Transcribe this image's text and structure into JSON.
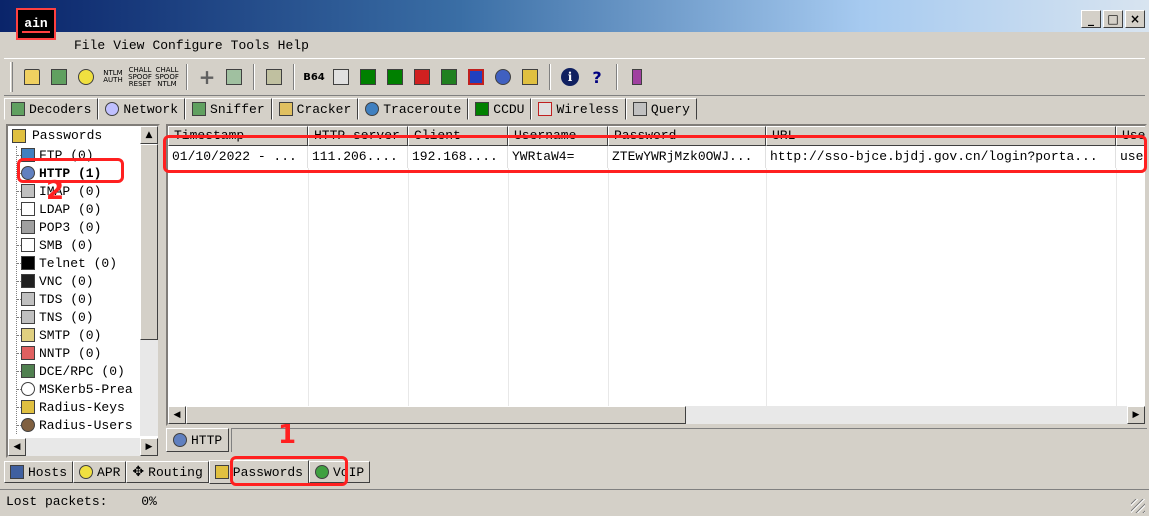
{
  "window": {
    "logo_text": "ain",
    "controls": [
      "_",
      "□",
      "×"
    ]
  },
  "menu": [
    "File",
    "View",
    "Configure",
    "Tools",
    "Help"
  ],
  "toolbar": {
    "ntlm_auth": "NTLM AUTH",
    "chall_spoof_reset": "CHALL SPOOF RESET",
    "chall_spoof_ntlm": "CHALL SPOOF NTLM",
    "b64": "B64"
  },
  "top_tabs": [
    {
      "label": "Decoders",
      "icon": "decoder-icon"
    },
    {
      "label": "Network",
      "icon": "network-icon"
    },
    {
      "label": "Sniffer",
      "icon": "sniffer-icon"
    },
    {
      "label": "Cracker",
      "icon": "cracker-icon"
    },
    {
      "label": "Traceroute",
      "icon": "traceroute-icon"
    },
    {
      "label": "CCDU",
      "icon": "ccdu-icon"
    },
    {
      "label": "Wireless",
      "icon": "wireless-icon"
    },
    {
      "label": "Query",
      "icon": "query-icon"
    }
  ],
  "tree": {
    "root": "Passwords",
    "items": [
      {
        "label": "FTP (0)"
      },
      {
        "label": "HTTP (1)"
      },
      {
        "label": "IMAP (0)"
      },
      {
        "label": "LDAP (0)"
      },
      {
        "label": "POP3 (0)"
      },
      {
        "label": "SMB (0)"
      },
      {
        "label": "Telnet (0)"
      },
      {
        "label": "VNC (0)"
      },
      {
        "label": "TDS (0)"
      },
      {
        "label": "TNS (0)"
      },
      {
        "label": "SMTP (0)"
      },
      {
        "label": "NNTP (0)"
      },
      {
        "label": "DCE/RPC (0)"
      },
      {
        "label": "MSKerb5-Prea"
      },
      {
        "label": "Radius-Keys"
      },
      {
        "label": "Radius-Users"
      }
    ]
  },
  "grid": {
    "columns": [
      "Timestamp",
      "HTTP server",
      "Client",
      "Username",
      "Password",
      "URL",
      "Use"
    ],
    "rows": [
      [
        "01/10/2022 - ...",
        "111.206....",
        "192.168....",
        "YWRtaW4=",
        "ZTEwYWRjMzk0OWJ...",
        "http://sso-bjce.bjdj.gov.cn/login?porta...",
        "use"
      ]
    ]
  },
  "subtab": {
    "label": "HTTP"
  },
  "bottom_tabs": [
    {
      "label": "Hosts"
    },
    {
      "label": "APR"
    },
    {
      "label": "Routing"
    },
    {
      "label": "Passwords"
    },
    {
      "label": "VoIP"
    }
  ],
  "status": {
    "label": "Lost packets:",
    "value": "0%"
  },
  "annotations": {
    "num1": "1",
    "num2": "2",
    "color": "#ff2020"
  }
}
